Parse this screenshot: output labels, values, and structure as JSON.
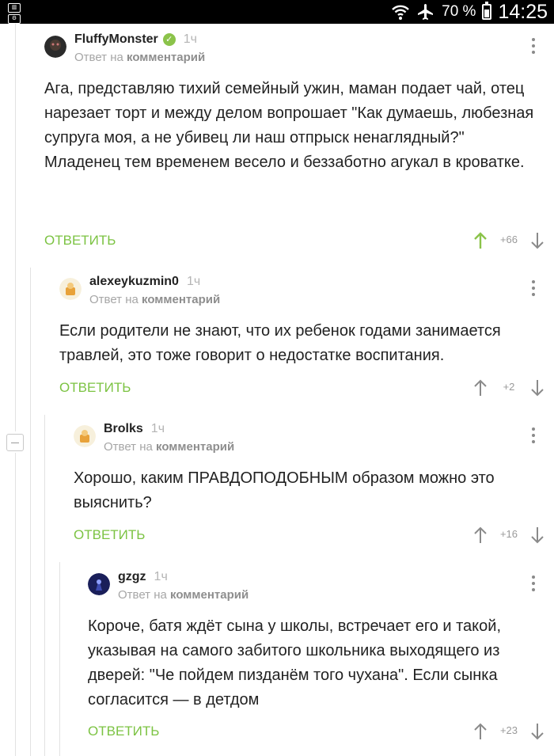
{
  "status_bar": {
    "battery": "70 %",
    "battery_level": 0.7,
    "time": "14:25",
    "icons": [
      "wifi-icon",
      "airplane-icon",
      "battery-icon"
    ]
  },
  "colors": {
    "accent_green": "#7cc343",
    "up_active": "#8bc34a",
    "muted": "#9a9a9a",
    "text": "#222222"
  },
  "comments": [
    {
      "author": "FluffyMonster",
      "verified": true,
      "time": "1ч",
      "reply_prefix": "Ответ на",
      "reply_target": "комментарий",
      "text": "Ага, представляю тихий семейный ужин, маман подает чай, отец нарезает торт и между делом вопрошает \"Как думаешь, любезная супруга моя, а не убивец ли наш отпрыск ненаглядный?\"\nМладенец тем временем весело и беззаботно агукал в кроватке.",
      "reply_label": "ОТВЕТИТЬ",
      "rating": "+66",
      "upvoted": true
    },
    {
      "author": "alexeykuzmin0",
      "verified": false,
      "time": "1ч",
      "reply_prefix": "Ответ на",
      "reply_target": "комментарий",
      "text": "Если родители не знают, что их ребенок годами занимается травлей, это тоже говорит о недостатке воспитания.",
      "reply_label": "ОТВЕТИТЬ",
      "rating": "+2",
      "upvoted": false
    },
    {
      "author": "Brolks",
      "verified": false,
      "time": "1ч",
      "reply_prefix": "Ответ на",
      "reply_target": "комментарий",
      "text": "Хорошо, каким ПРАВДОПОДОБНЫМ образом можно это выяснить?",
      "reply_label": "ОТВЕТИТЬ",
      "rating": "+16",
      "upvoted": false
    },
    {
      "author": "gzgz",
      "verified": false,
      "time": "1ч",
      "reply_prefix": "Ответ на",
      "reply_target": "комментарий",
      "text": "Короче, батя ждёт сына у школы, встречает его и такой, указывая на самого забитого школьника выходящего из дверей: \"Че пойдем пизданём того чухана\". Если сынка согласится — в детдом",
      "reply_label": "ОТВЕТИТЬ",
      "rating": "+23",
      "upvoted": false
    }
  ]
}
